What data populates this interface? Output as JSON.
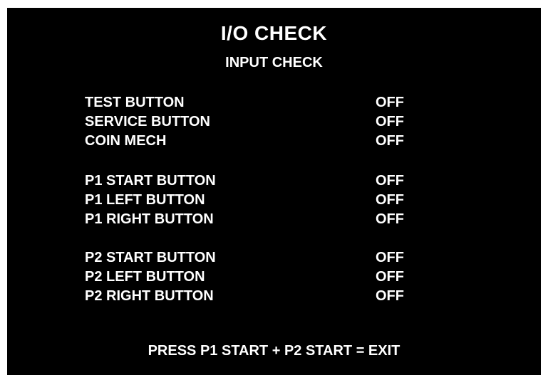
{
  "header": {
    "title": "I/O CHECK",
    "subtitle": "INPUT CHECK"
  },
  "groups": [
    {
      "rows": [
        {
          "label": "TEST BUTTON",
          "value": "OFF"
        },
        {
          "label": "SERVICE BUTTON",
          "value": "OFF"
        },
        {
          "label": "COIN MECH",
          "value": "OFF"
        }
      ]
    },
    {
      "rows": [
        {
          "label": "P1 START BUTTON",
          "value": "OFF"
        },
        {
          "label": "P1 LEFT BUTTON",
          "value": "OFF"
        },
        {
          "label": "P1 RIGHT BUTTON",
          "value": "OFF"
        }
      ]
    },
    {
      "rows": [
        {
          "label": "P2 START BUTTON",
          "value": "OFF"
        },
        {
          "label": "P2 LEFT BUTTON",
          "value": "OFF"
        },
        {
          "label": "P2 RIGHT BUTTON",
          "value": "OFF"
        }
      ]
    }
  ],
  "footer": {
    "instruction": "PRESS P1 START + P2 START = EXIT"
  },
  "colors": {
    "background": "#000000",
    "text": "#ffffff",
    "frame": "#ffffff"
  }
}
